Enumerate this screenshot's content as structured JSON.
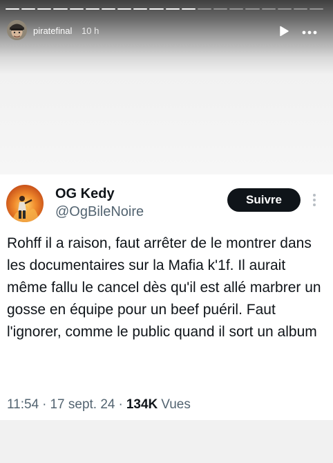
{
  "story": {
    "username": "piratefinal",
    "time_ago": "10 h",
    "progress": {
      "segments": 20,
      "completed": 12
    },
    "icons": {
      "play": "play-icon",
      "more": "more-horizontal-icon"
    }
  },
  "tweet": {
    "display_name": "OG Kedy",
    "handle": "@OgBileNoire",
    "follow_label": "Suivre",
    "text": "Rohff il a raison, faut arrêter de le montrer dans les documentaires sur la Mafia k'1f. Il aurait même fallu le cancel dès qu'il est allé marbrer un gosse en équipe pour un beef puéril. Faut l'ignorer, comme le public quand il sort un album",
    "time": "11:54",
    "separator": "·",
    "date": "17 sept. 24",
    "views_count": "134K",
    "views_label": "Vues",
    "icons": {
      "more": "more-vertical-icon"
    }
  },
  "colors": {
    "text_primary": "#0f1419",
    "text_secondary": "#536471",
    "follow_bg": "#0f1419"
  }
}
